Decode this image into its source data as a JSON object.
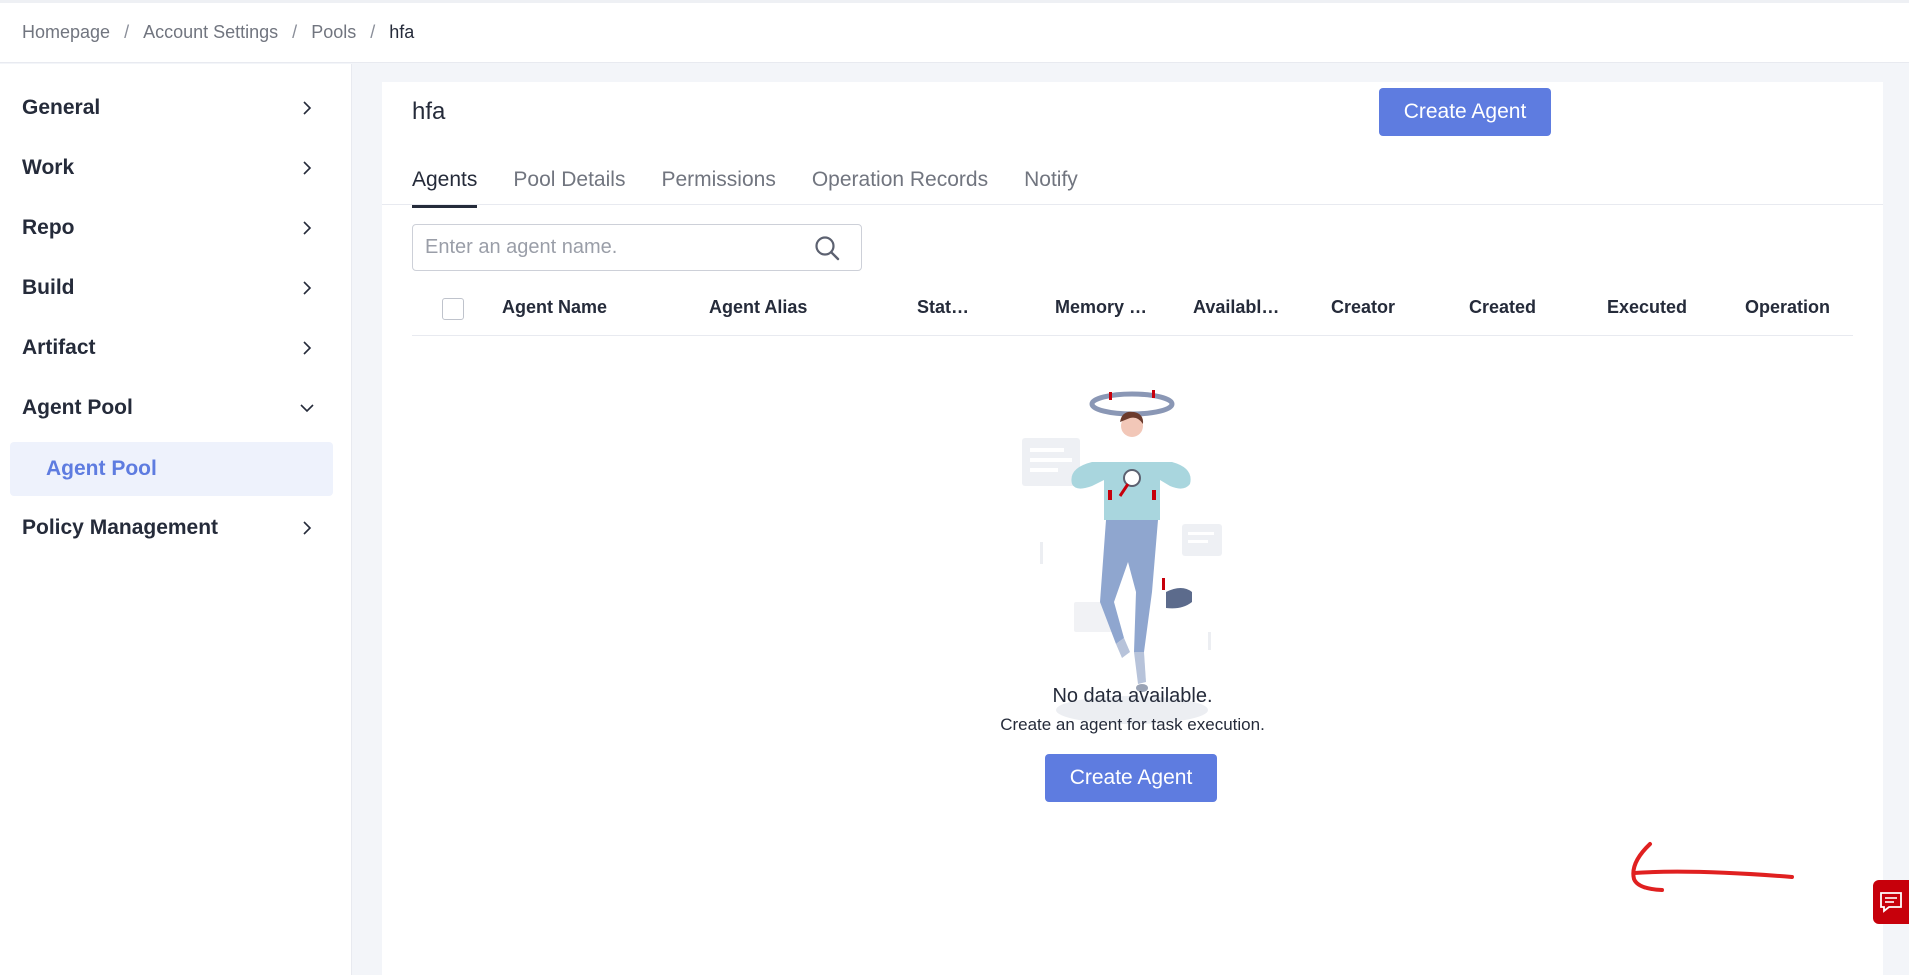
{
  "breadcrumb": {
    "items": [
      "Homepage",
      "Account Settings",
      "Pools",
      "hfa"
    ],
    "separator": "/"
  },
  "sidebar": {
    "items": [
      {
        "label": "General",
        "icon": "chevron-right-icon"
      },
      {
        "label": "Work",
        "icon": "chevron-right-icon"
      },
      {
        "label": "Repo",
        "icon": "chevron-right-icon"
      },
      {
        "label": "Build",
        "icon": "chevron-right-icon"
      },
      {
        "label": "Artifact",
        "icon": "chevron-right-icon"
      },
      {
        "label": "Agent Pool",
        "icon": "chevron-down-icon",
        "expanded": true
      },
      {
        "label": "Policy Management",
        "icon": "chevron-right-icon"
      }
    ],
    "active_sub_item": "Agent Pool"
  },
  "main": {
    "title": "hfa",
    "create_button": "Create Agent",
    "tabs": [
      {
        "label": "Agents",
        "active": true
      },
      {
        "label": "Pool Details",
        "active": false
      },
      {
        "label": "Permissions",
        "active": false
      },
      {
        "label": "Operation Records",
        "active": false
      },
      {
        "label": "Notify",
        "active": false
      }
    ],
    "search": {
      "placeholder": "Enter an agent name.",
      "value": ""
    },
    "table": {
      "columns": [
        "Agent Name",
        "Agent Alias",
        "Stat…",
        "Memory …",
        "Availabl…",
        "Creator",
        "Created",
        "Executed",
        "Operation"
      ],
      "rows": []
    },
    "empty_state": {
      "title": "No data available.",
      "description": "Create an agent for task execution.",
      "button": "Create Agent"
    }
  },
  "colors": {
    "primary": "#5e7ce0",
    "annotation": "#e02020",
    "feedback": "#c7000b"
  }
}
